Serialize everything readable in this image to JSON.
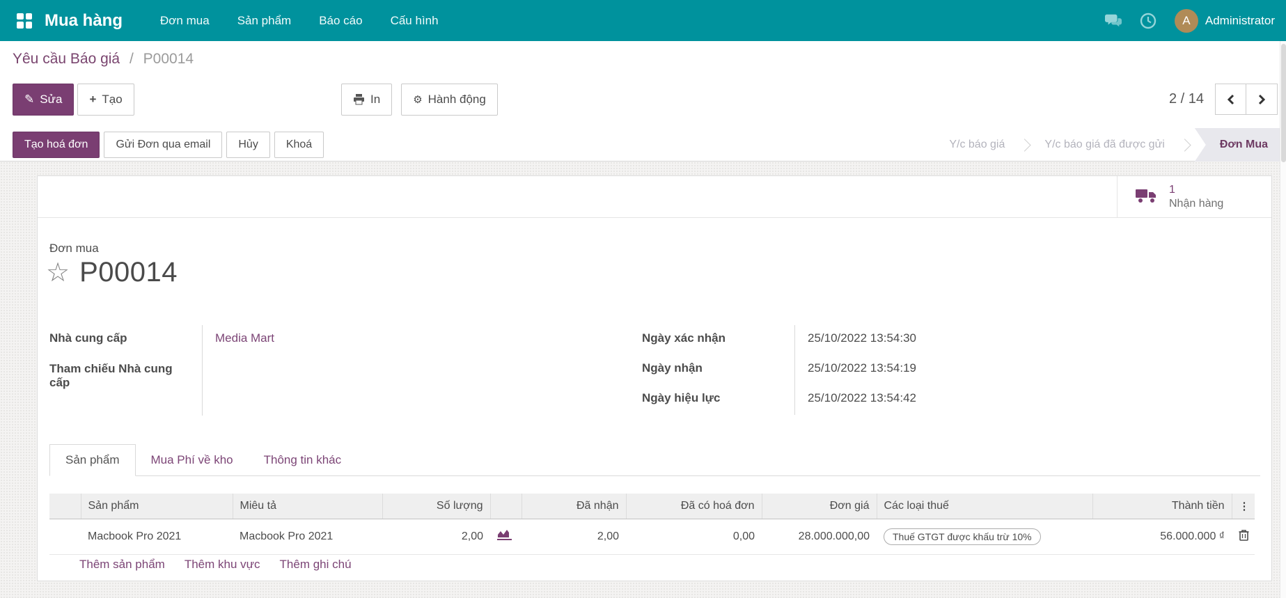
{
  "navbar": {
    "brand": "Mua hàng",
    "menus": [
      "Đơn mua",
      "Sản phẩm",
      "Báo cáo",
      "Cấu hình"
    ],
    "user": {
      "initial": "A",
      "name": "Administrator"
    }
  },
  "breadcrumb": {
    "parent": "Yêu cầu Báo giá",
    "separator": "/",
    "current": "P00014"
  },
  "controls": {
    "edit": "Sửa",
    "create": "Tạo",
    "print": "In",
    "action": "Hành động",
    "pager": "2 / 14"
  },
  "statusbar": {
    "buttons": [
      {
        "label": "Tạo hoá đơn",
        "primary": true
      },
      {
        "label": "Gửi Đơn qua email",
        "primary": false
      },
      {
        "label": "Hủy",
        "primary": false
      },
      {
        "label": "Khoá",
        "primary": false
      }
    ],
    "steps": [
      {
        "label": "Y/c báo giá",
        "active": false
      },
      {
        "label": "Y/c báo giá đã được gửi",
        "active": false
      },
      {
        "label": "Đơn Mua",
        "active": true
      }
    ]
  },
  "smart_button": {
    "count": "1",
    "label": "Nhận hàng"
  },
  "sheet": {
    "doc_type_label": "Đơn mua",
    "title": "P00014",
    "fields_left": [
      {
        "label": "Nhà cung cấp",
        "value": "Media Mart"
      },
      {
        "label": "Tham chiếu Nhà cung cấp",
        "value": ""
      }
    ],
    "fields_right": [
      {
        "label": "Ngày xác nhận",
        "value": "25/10/2022 13:54:30"
      },
      {
        "label": "Ngày nhận",
        "value": "25/10/2022 13:54:19"
      },
      {
        "label": "Ngày hiệu lực",
        "value": "25/10/2022 13:54:42"
      }
    ]
  },
  "tabs": [
    {
      "label": "Sản phẩm",
      "active": true
    },
    {
      "label": "Mua Phí về kho",
      "active": false
    },
    {
      "label": "Thông tin khác",
      "active": false
    }
  ],
  "table": {
    "headers": {
      "product": "Sản phẩm",
      "description": "Miêu tả",
      "qty": "Số lượng",
      "received": "Đã nhận",
      "billed": "Đã có hoá đơn",
      "unit_price": "Đơn giá",
      "taxes": "Các loại thuế",
      "subtotal": "Thành tiền"
    },
    "rows": [
      {
        "product": "Macbook Pro 2021",
        "description": "Macbook Pro 2021",
        "qty": "2,00",
        "received": "2,00",
        "billed": "0,00",
        "unit_price": "28.000.000,00",
        "taxes": "Thuế GTGT được khấu trừ 10%",
        "subtotal": "56.000.000 ₫"
      }
    ],
    "add_links": [
      "Thêm sản phẩm",
      "Thêm khu vực",
      "Thêm ghi chú"
    ]
  },
  "colors": {
    "navbar": "#00929d",
    "primary_button": "#7a3e72",
    "link": "#7c4576",
    "avatar_bg": "#b08b57",
    "active_step_bg": "#e8e8ed"
  }
}
